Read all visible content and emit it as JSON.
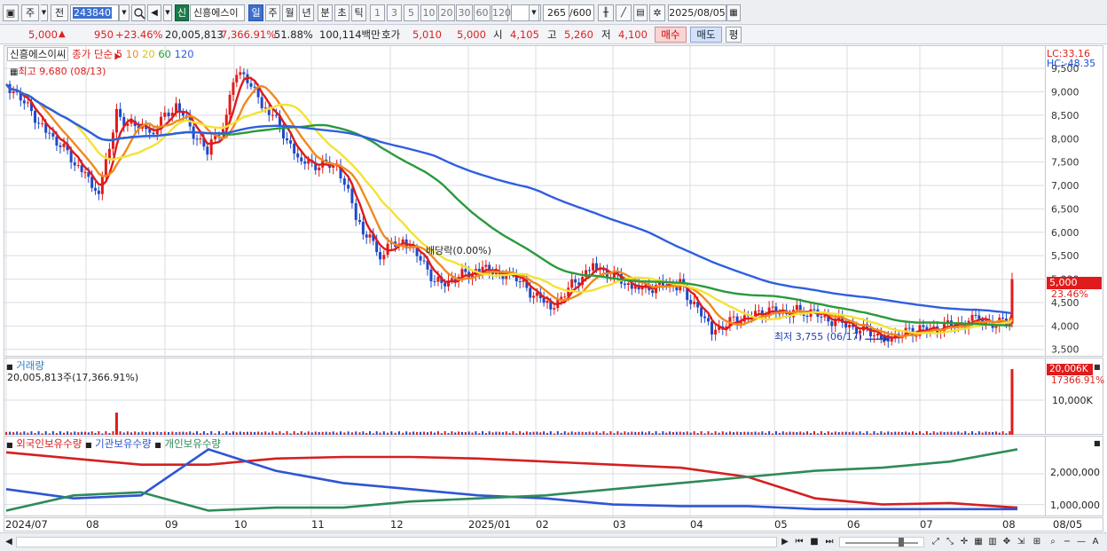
{
  "toolbar": {
    "period_label": "주",
    "prev_label": "전",
    "code": "243840",
    "new_badge": "신",
    "stock_name": "신흥에스이씨",
    "periods": [
      "일",
      "주",
      "월",
      "년",
      "분",
      "초",
      "틱"
    ],
    "intervals": [
      "1",
      "3",
      "5",
      "10",
      "20",
      "30",
      "60",
      "120"
    ],
    "count_value": "265",
    "count_max": "/600",
    "date": "2025/08/05"
  },
  "infobar": {
    "price": "5,000",
    "up_arrow": "▲",
    "change": "950",
    "change_pct": "+23.46%",
    "volume": "20,005,813",
    "volume_pct": "7,366.91%",
    "turnover": "51.88%",
    "amount": "100,114백만",
    "hoga_label": "호가",
    "hoga_ask": "5,010",
    "hoga_bid": "5,000",
    "open_label": "시",
    "open": "4,105",
    "high_label": "고",
    "high": "5,260",
    "low_label": "저",
    "low": "4,100",
    "buy_label": "매수",
    "sell_label": "매도",
    "avg_label": "평"
  },
  "price_panel": {
    "stock_tag": "신흥에스이씨",
    "ma_label": "종가 단순",
    "ma_periods": [
      "5",
      "10",
      "20",
      "60",
      "120"
    ],
    "ma_colors": [
      "#e01b1b",
      "#f08a1c",
      "#f4e234",
      "#2a9a3a",
      "#2f5fe0"
    ],
    "high_marker": "최고 9,680 (08/13)",
    "low_marker": "최저 3,755 (06/17)",
    "dividend_label": "배당락(0.00%)",
    "lc": "LC:33.16",
    "hc": "HC:-48.35",
    "last_price": "5,000",
    "last_pct": "23.46%"
  },
  "volume_panel": {
    "title": "거래량",
    "value_text": "20,005,813주(17,366.91%)",
    "last_volume": "20,006K",
    "last_pct": "17366.91%",
    "axis_label": "10,000K"
  },
  "holding_panel": {
    "legend": [
      "외국인보유수량",
      "기관보유수량",
      "개인보유수량"
    ],
    "colors": [
      "#d42020",
      "#2f55d4",
      "#2e8b57"
    ],
    "axis_labels": [
      "2,000,000",
      "1,000,000"
    ]
  },
  "dates": [
    "2024/07",
    "08",
    "09",
    "10",
    "11",
    "12",
    "2025/01",
    "02",
    "03",
    "04",
    "05",
    "06",
    "07",
    "08"
  ],
  "date_axis_end": "08/05",
  "chart_data": {
    "type": "candlestick",
    "y_axis_ticks": [
      3500,
      4000,
      4500,
      5000,
      5500,
      6000,
      6500,
      7000,
      7500,
      8000,
      8500,
      9000,
      9500
    ],
    "ylim": [
      3400,
      9900
    ],
    "x_dates": [
      "2024/07",
      "08",
      "09",
      "10",
      "11",
      "12",
      "2025/01",
      "02",
      "03",
      "04",
      "05",
      "06",
      "07",
      "08"
    ],
    "close_series": [
      {
        "date": "2024/07/01",
        "close": 9200
      },
      {
        "date": "2024/07/15",
        "close": 8300
      },
      {
        "date": "2024/07/29",
        "close": 7400
      },
      {
        "date": "2024/08/06",
        "close": 6900
      },
      {
        "date": "2024/08/13",
        "close": 8500
      },
      {
        "date": "2024/08/26",
        "close": 8100
      },
      {
        "date": "2024/09/06",
        "close": 8700
      },
      {
        "date": "2024/09/20",
        "close": 7700
      },
      {
        "date": "2024/09/27",
        "close": 8300
      },
      {
        "date": "2024/10/02",
        "close": 9500
      },
      {
        "date": "2024/10/15",
        "close": 8600
      },
      {
        "date": "2024/10/28",
        "close": 7500
      },
      {
        "date": "2024/11/11",
        "close": 7400
      },
      {
        "date": "2024/11/20",
        "close": 6200
      },
      {
        "date": "2024/11/28",
        "close": 5500
      },
      {
        "date": "2024/12/06",
        "close": 5900
      },
      {
        "date": "2024/12/20",
        "close": 4900
      },
      {
        "date": "2025/01/06",
        "close": 5200
      },
      {
        "date": "2025/01/20",
        "close": 5100
      },
      {
        "date": "2025/02/07",
        "close": 4400
      },
      {
        "date": "2025/02/24",
        "close": 5300
      },
      {
        "date": "2025/03/10",
        "close": 4800
      },
      {
        "date": "2025/03/28",
        "close": 4900
      },
      {
        "date": "2025/04/09",
        "close": 3900
      },
      {
        "date": "2025/04/25",
        "close": 4300
      },
      {
        "date": "2025/05/15",
        "close": 4300
      },
      {
        "date": "2025/06/17",
        "close": 3755
      },
      {
        "date": "2025/07/01",
        "close": 3900
      },
      {
        "date": "2025/07/22",
        "close": 4100
      },
      {
        "date": "2025/08/04",
        "close": 4050
      },
      {
        "date": "2025/08/05",
        "close": 5000
      }
    ],
    "volume_ylabel": "10,000K",
    "holding_series": [
      {
        "name": "외국인보유수량",
        "values": [
          2700000,
          2500000,
          2300000,
          2300000,
          2500000,
          2550000,
          2550000,
          2500000,
          2400000,
          2300000,
          2200000,
          1900000,
          1200000,
          1000000,
          1050000,
          900000
        ]
      },
      {
        "name": "기관보유수량",
        "values": [
          1500000,
          1200000,
          1300000,
          2800000,
          2100000,
          1700000,
          1500000,
          1300000,
          1200000,
          1000000,
          950000,
          950000,
          850000,
          850000,
          850000,
          850000
        ]
      },
      {
        "name": "개인보유수량",
        "values": [
          800000,
          1300000,
          1400000,
          800000,
          900000,
          900000,
          1100000,
          1200000,
          1300000,
          1500000,
          1700000,
          1900000,
          2100000,
          2200000,
          2400000,
          2800000
        ]
      }
    ],
    "holding_ylim": [
      700000,
      3100000
    ]
  }
}
